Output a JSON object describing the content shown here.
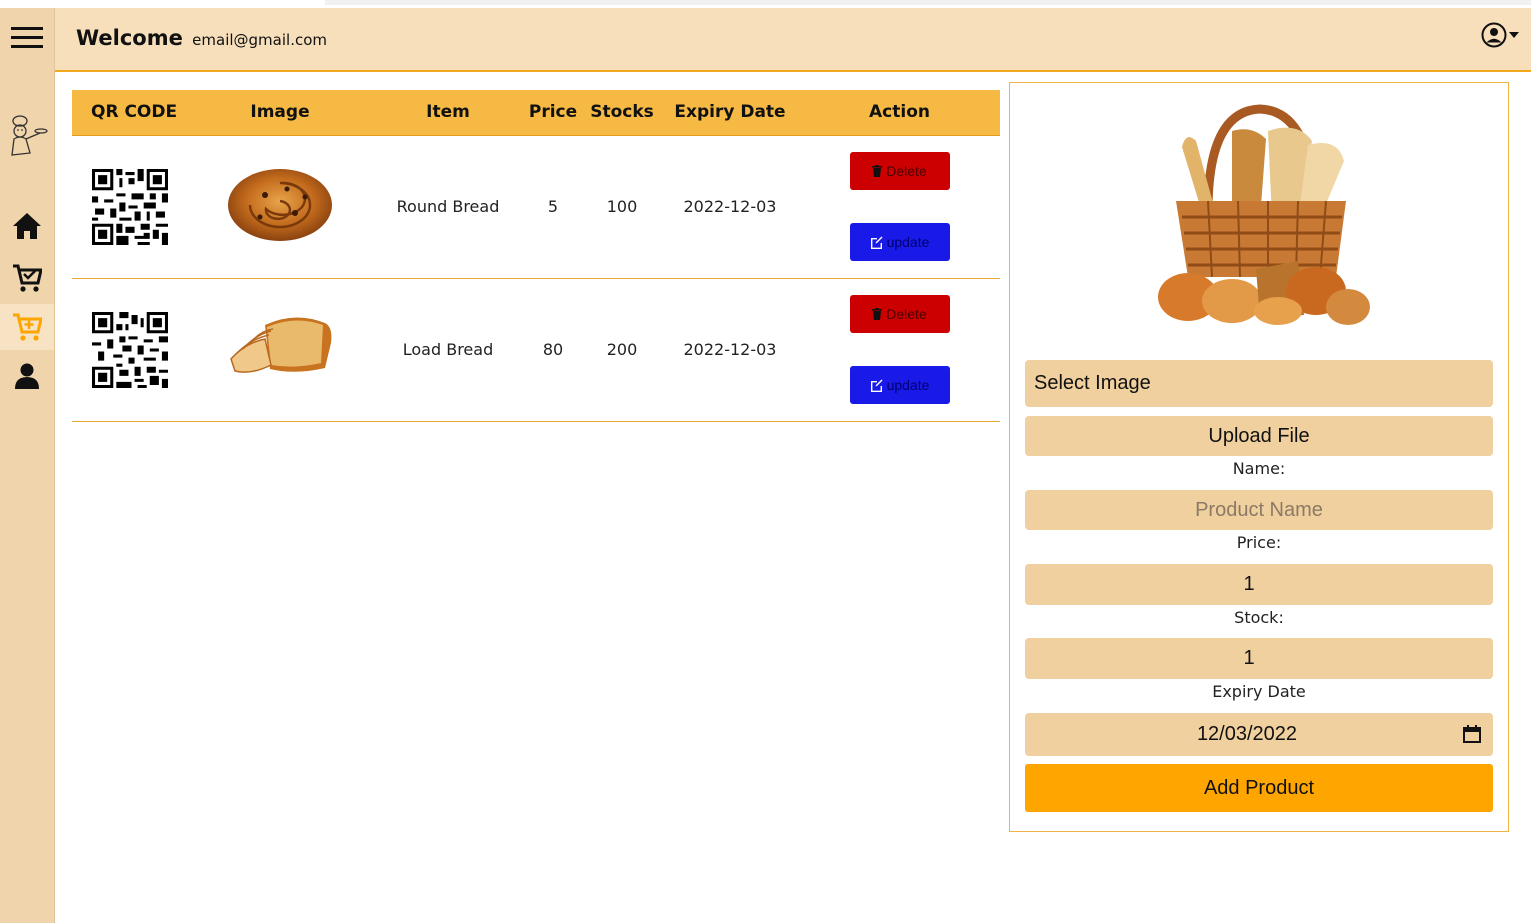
{
  "header": {
    "welcome": "Welcome",
    "email": "email@gmail.com"
  },
  "sidebar": {
    "items": [
      {
        "icon": "menu-icon"
      },
      {
        "icon": "chef-logo"
      },
      {
        "icon": "home-icon"
      },
      {
        "icon": "cart-check-icon"
      },
      {
        "icon": "cart-plus-icon",
        "active": true,
        "color": "#ffa500"
      },
      {
        "icon": "user-icon"
      }
    ]
  },
  "table": {
    "columns": [
      "QR CODE",
      "Image",
      "Item",
      "Price",
      "Stocks",
      "Expiry Date",
      "Action"
    ],
    "rows": [
      {
        "item": "Round Bread",
        "price": "5",
        "stocks": "100",
        "expiry": "2022-12-03",
        "image": "round-bread-photo"
      },
      {
        "item": "Load Bread",
        "price": "80",
        "stocks": "200",
        "expiry": "2022-12-03",
        "image": "loaf-bread-photo"
      }
    ],
    "delete_label": "Delete",
    "update_label": "update"
  },
  "form": {
    "select_image": "Select Image",
    "upload_file": "Upload File",
    "name_label": "Name:",
    "name_placeholder": "Product Name",
    "price_label": "Price:",
    "price_value": "1",
    "stock_label": "Stock:",
    "stock_value": "1",
    "expiry_label": "Expiry Date",
    "expiry_value": "12/03/2022",
    "add_button": "Add Product"
  },
  "colors": {
    "sidebar": "#f0d4ab",
    "header": "#f6dfba",
    "table_header": "#f6b944",
    "delete": "#cc0000",
    "update": "#1a1ae8",
    "field": "#f0d09e",
    "add_button": "#ffa500"
  }
}
